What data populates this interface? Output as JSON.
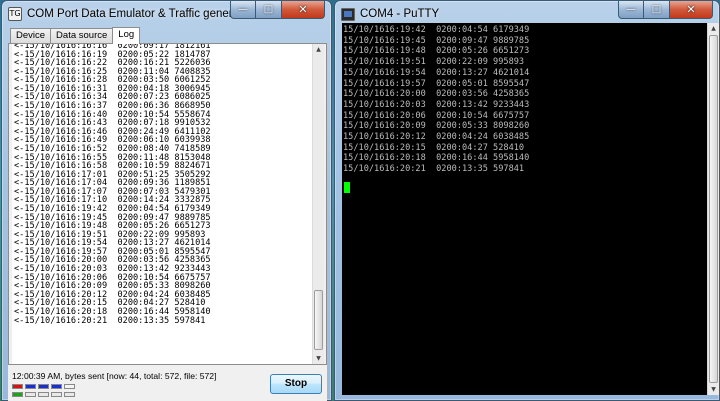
{
  "left_window": {
    "title": "COM Port Data Emulator & Traffic generator",
    "app_icon_text": "TG",
    "controls": {
      "minimize": "—",
      "maximize": "□",
      "close": "✕"
    },
    "tabs": [
      {
        "label": "Device",
        "active": false
      },
      {
        "label": "Data source",
        "active": false
      },
      {
        "label": "Log",
        "active": true
      }
    ],
    "log_lines": [
      "<-15/10/1616:16:16  0200:09:17 1812161",
      "<-15/10/1616:16:19  0200:05:22 1814787",
      "<-15/10/1616:16:22  0200:16:21 5226036",
      "<-15/10/1616:16:25  0200:11:04 7408835",
      "<-15/10/1616:16:28  0200:03:50 6061252",
      "<-15/10/1616:16:31  0200:04:18 3006945",
      "<-15/10/1616:16:34  0200:07:23 6086025",
      "<-15/10/1616:16:37  0200:06:36 8668950",
      "<-15/10/1616:16:40  0200:10:54 5558674",
      "<-15/10/1616:16:43  0200:07:18 9910532",
      "<-15/10/1616:16:46  0200:24:49 6411102",
      "<-15/10/1616:16:49  0200:06:10 6039938",
      "<-15/10/1616:16:52  0200:08:40 7418589",
      "<-15/10/1616:16:55  0200:11:48 8153048",
      "<-15/10/1616:16:58  0200:10:59 8824671",
      "<-15/10/1616:17:01  0200:51:25 3505292",
      "<-15/10/1616:17:04  0200:09:36 1189851",
      "<-15/10/1616:17:07  0200:07:03 5479301",
      "<-15/10/1616:17:10  0200:14:24 3332875",
      "<-15/10/1616:19:42  0200:04:54 6179349",
      "<-15/10/1616:19:45  0200:09:47 9889785",
      "<-15/10/1616:19:48  0200:05:26 6651273",
      "<-15/10/1616:19:51  0200:22:09 995893",
      "<-15/10/1616:19:54  0200:13:27 4621014",
      "<-15/10/1616:19:57  0200:05:01 8595547",
      "<-15/10/1616:20:00  0200:03:56 4258365",
      "<-15/10/1616:20:03  0200:13:42 9233443",
      "<-15/10/1616:20:06  0200:10:54 6675757",
      "<-15/10/1616:20:09  0200:05:33 8098260",
      "<-15/10/1616:20:12  0200:04:24 6038485",
      "<-15/10/1616:20:15  0200:04:27 528410",
      "<-15/10/1616:20:18  0200:16:44 5958140",
      "<-15/10/1616:20:21  0200:13:35 597841"
    ],
    "status_text": "12:00:39 AM, bytes sent [now: 44, total: 572, file: 572]",
    "led_rows": [
      [
        "#e01010",
        "#1a2fd0",
        "#1a2fd0",
        "#1a2fd0",
        "#f4f4f4"
      ],
      [
        "#14a814",
        "#e8e8e8",
        "#e8e8e8",
        "#e8e8e8",
        "#e8e8e8"
      ]
    ],
    "stop_button": "Stop"
  },
  "right_window": {
    "title": "COM4 - PuTTY",
    "controls": {
      "minimize": "—",
      "maximize": "□",
      "close": "✕"
    },
    "terminal_lines": [
      "15/10/1616:19:42  0200:04:54 6179349",
      "15/10/1616:19:45  0200:09:47 9889785",
      "15/10/1616:19:48  0200:05:26 6651273",
      "15/10/1616:19:51  0200:22:09 995893",
      "15/10/1616:19:54  0200:13:27 4621014",
      "15/10/1616:19:57  0200:05:01 8595547",
      "15/10/1616:20:00  0200:03:56 4258365",
      "15/10/1616:20:03  0200:13:42 9233443",
      "15/10/1616:20:06  0200:10:54 6675757",
      "15/10/1616:20:09  0200:05:33 8098260",
      "15/10/1616:20:12  0200:04:24 6038485",
      "15/10/1616:20:15  0200:04:27 528410",
      "15/10/1616:20:18  0200:16:44 5958140",
      "15/10/1616:20:21  0200:13:35 597841"
    ],
    "cursor_color": "#00ff00",
    "terminal_fg": "#bbbbbb",
    "terminal_bg": "#000000"
  },
  "scroll_arrows": {
    "up": "▲",
    "down": "▼"
  }
}
